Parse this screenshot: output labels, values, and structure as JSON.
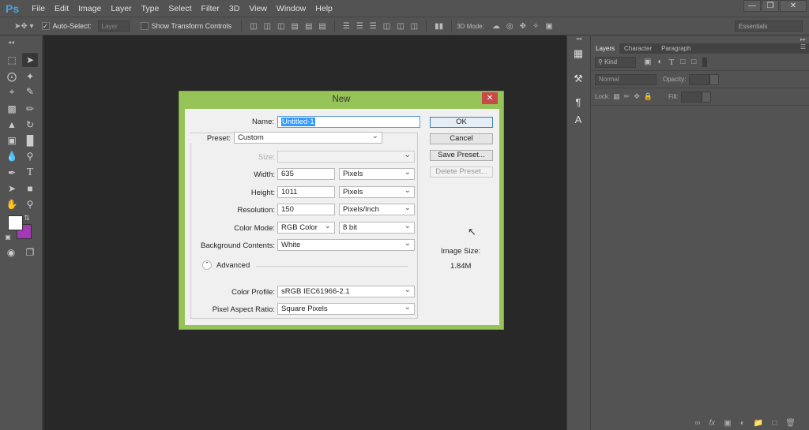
{
  "app": {
    "logo": "Ps",
    "menu": [
      "File",
      "Edit",
      "Image",
      "Layer",
      "Type",
      "Select",
      "Filter",
      "3D",
      "View",
      "Window",
      "Help"
    ],
    "window_controls": [
      "minimize",
      "restore",
      "close"
    ]
  },
  "options_bar": {
    "auto_select_label": "Auto-Select:",
    "auto_select_checked": true,
    "auto_select_target": "Layer",
    "show_transform_label": "Show Transform Controls",
    "show_transform_checked": false,
    "mode_3d_label": "3D Mode:",
    "workspace": "Essentials"
  },
  "toolbox": {
    "foreground_color": "#ffffff",
    "background_color": "#a23ab3"
  },
  "panel": {
    "tabs": [
      "Layers",
      "Character",
      "Paragraph"
    ],
    "active_tab": "Layers",
    "filter_kind": "Kind",
    "blend_mode": "Normal",
    "opacity_label": "Opacity:",
    "lock_label": "Lock:",
    "fill_label": "Fill:"
  },
  "dialog": {
    "title": "New",
    "name_label": "Name:",
    "name_value": "Untitled-1",
    "preset_label": "Preset:",
    "preset_value": "Custom",
    "size_label": "Size:",
    "size_value": "",
    "width_label": "Width:",
    "width_value": "635",
    "width_unit": "Pixels",
    "height_label": "Height:",
    "height_value": "1011",
    "height_unit": "Pixels",
    "resolution_label": "Resolution:",
    "resolution_value": "150",
    "resolution_unit": "Pixels/Inch",
    "color_mode_label": "Color Mode:",
    "color_mode_value": "RGB Color",
    "bit_depth": "8 bit",
    "bg_label": "Background Contents:",
    "bg_value": "White",
    "advanced_label": "Advanced",
    "profile_label": "Color Profile:",
    "profile_value": "sRGB IEC61966-2.1",
    "par_label": "Pixel Aspect Ratio:",
    "par_value": "Square Pixels",
    "buttons": {
      "ok": "OK",
      "cancel": "Cancel",
      "save_preset": "Save Preset...",
      "delete_preset": "Delete Preset..."
    },
    "image_size_label": "Image Size:",
    "image_size_value": "1.84M",
    "accent": "#97c459"
  }
}
